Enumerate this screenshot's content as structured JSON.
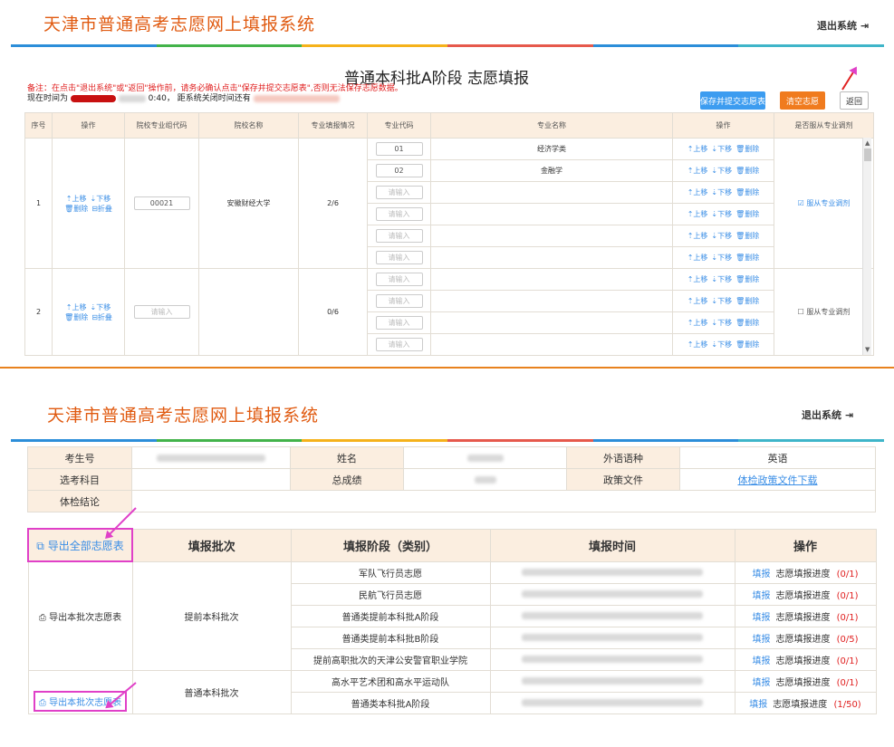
{
  "top": {
    "title": "天津市普通高考志愿网上填报系统",
    "logout": "退出系统",
    "page_title": "普通本科批A阶段 志愿填报",
    "notice": "备注：在点击\"退出系统\"或\"返回\"操作前，请务必确认点击\"保存并提交志愿表\",否则无法保存志愿数据。",
    "time_label": "现在时间为",
    "time_value": "0:40，",
    "countdown_label": "距系统关闭时间还有",
    "buttons": {
      "save": "保存并提交志愿表",
      "clear": "清空志愿",
      "back": "返回"
    },
    "headers": [
      "序号",
      "操作",
      "院校专业组代码",
      "院校名称",
      "专业填报情况",
      "专业代码",
      "专业名称",
      "操作",
      "是否服从专业调剂"
    ],
    "row_ops": {
      "up": "上移",
      "down": "下移",
      "del": "删除",
      "fold": "折叠"
    },
    "placeholder": "请输入",
    "groups": [
      {
        "no": "1",
        "code": "00021",
        "school": "安徽财经大学",
        "status": "2/6",
        "adjust": "服从专业调剂",
        "adjust_checked": true,
        "majors": [
          {
            "code": "01",
            "name": "经济学类"
          },
          {
            "code": "02",
            "name": "金融学"
          },
          {
            "code": "",
            "name": ""
          },
          {
            "code": "",
            "name": ""
          },
          {
            "code": "",
            "name": ""
          },
          {
            "code": "",
            "name": ""
          }
        ]
      },
      {
        "no": "2",
        "code": "",
        "school": "",
        "status": "0/6",
        "adjust": "服从专业调剂",
        "adjust_checked": false,
        "majors": [
          {
            "code": "",
            "name": ""
          },
          {
            "code": "",
            "name": ""
          },
          {
            "code": "",
            "name": ""
          },
          {
            "code": "",
            "name": ""
          }
        ]
      }
    ]
  },
  "bottom": {
    "title": "天津市普通高考志愿网上填报系统",
    "logout": "退出系统",
    "info": {
      "exam_no_label": "考生号",
      "name_label": "姓名",
      "lang_label": "外语语种",
      "lang_value": "英语",
      "subjects_label": "选考科目",
      "score_label": "总成绩",
      "policy_label": "政策文件",
      "policy_link": "体检政策文件下载",
      "physical_label": "体检结论"
    },
    "export_all": "导出全部志愿表",
    "headers": [
      "填报批次",
      "填报阶段（类别）",
      "填报时间",
      "操作"
    ],
    "export_batch": "导出本批次志愿表",
    "fill": "填报",
    "progress_label": "志愿填报进度",
    "batches": [
      {
        "name": "提前本科批次",
        "stages": [
          {
            "name": "军队飞行员志愿",
            "progress": "(0/1)"
          },
          {
            "name": "民航飞行员志愿",
            "progress": "(0/1)"
          },
          {
            "name": "普通类提前本科批A阶段",
            "progress": "(0/1)"
          },
          {
            "name": "普通类提前本科批B阶段",
            "progress": "(0/5)"
          },
          {
            "name": "提前高职批次的天津公安警官职业学院",
            "progress": "(0/1)"
          }
        ]
      },
      {
        "name": "普通本科批次",
        "stages": [
          {
            "name": "高水平艺术团和高水平运动队",
            "progress": "(0/1)"
          },
          {
            "name": "普通类本科批A阶段",
            "progress": "(1/50)"
          }
        ]
      }
    ]
  },
  "colors": {
    "title": "#e05a10",
    "link": "#3a8ee6",
    "orange_btn": "#f07b1e",
    "blue_btn": "#3c9cf0",
    "header_bg": "#fbeee0",
    "arrow": "#e040c8",
    "progress": "#e02020"
  }
}
